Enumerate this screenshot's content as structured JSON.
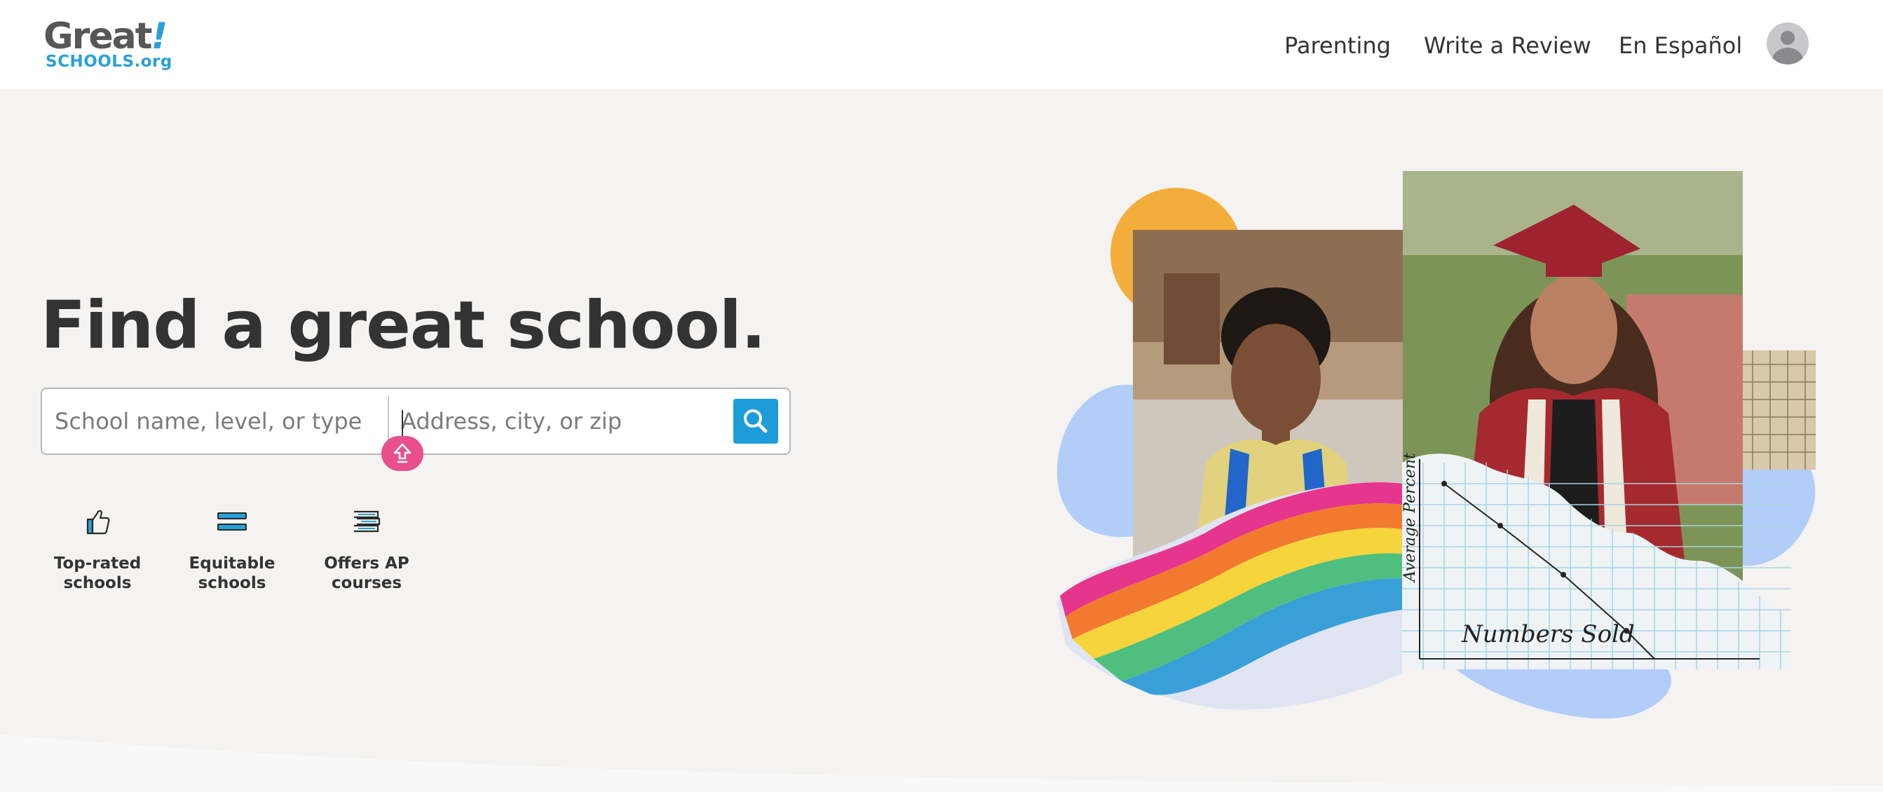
{
  "header": {
    "logo": {
      "word": "Great",
      "bang": "!",
      "sub": "SCHOOLS.org"
    },
    "nav": [
      {
        "label": "Parenting"
      },
      {
        "label": "Write a Review"
      },
      {
        "label": "En Español"
      }
    ],
    "avatar_icon": "user-avatar-icon"
  },
  "hero": {
    "title": "Find a great school.",
    "search": {
      "school_placeholder": "School name, level, or type",
      "address_placeholder": "Address, city, or zip",
      "search_icon": "magnifier-icon",
      "swap_icon": "swap-arrow-icon"
    },
    "quick_links": [
      {
        "label": "Top-rated schools",
        "icon": "thumbs-up-icon"
      },
      {
        "label": "Equitable schools",
        "icon": "equal-bars-icon"
      },
      {
        "label": "Offers AP courses",
        "icon": "book-stack-icon"
      }
    ]
  },
  "collage": {
    "graph_caption": "Numbers Sold",
    "graph_axis_label": "Average Percent"
  },
  "colors": {
    "accent_blue": "#1c9dd9",
    "accent_pink": "#e84f8b",
    "background": "#f4f3f1",
    "text": "#333333",
    "sun_orange": "#f3ad3a",
    "blob_blue": "#b2cdf8"
  }
}
